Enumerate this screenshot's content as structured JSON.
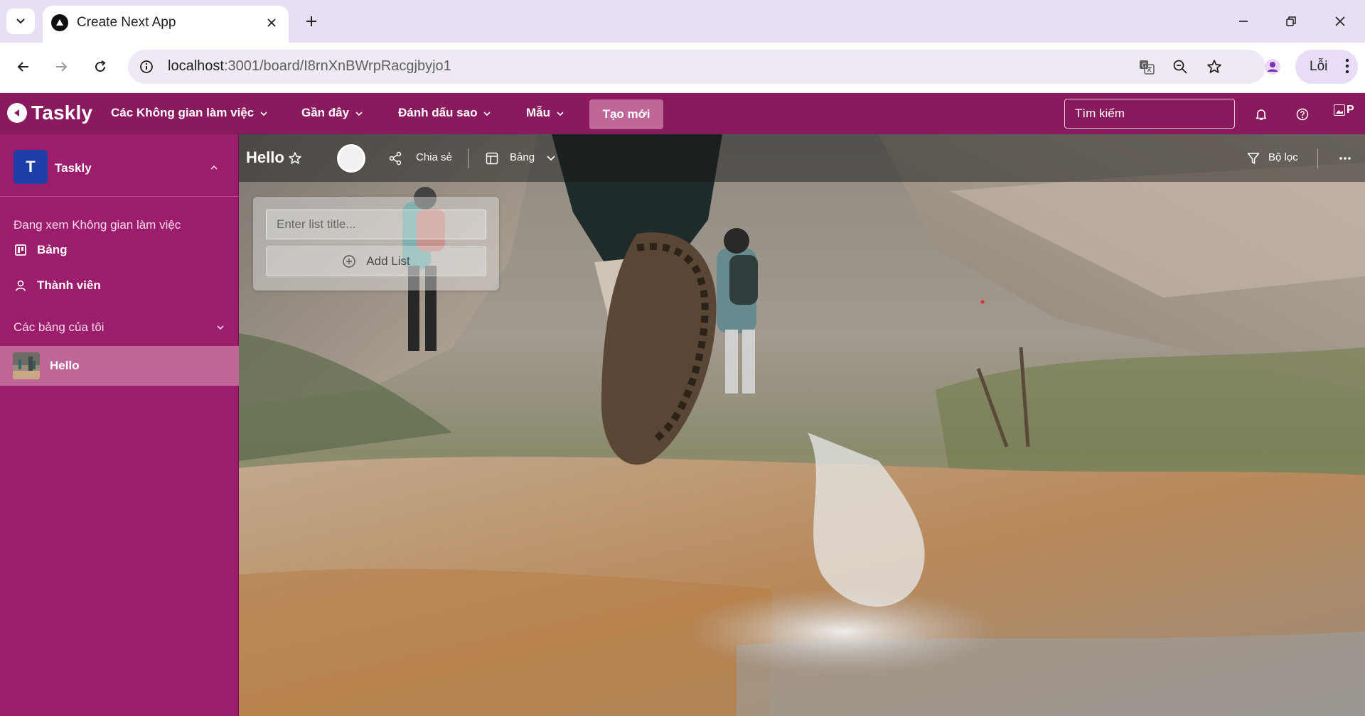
{
  "browser": {
    "tab_title": "Create Next App",
    "url_host": "localhost",
    "url_path": ":3001/board/I8rnXnBWrpRacgjbyjo1",
    "profile_chip_label": "Lỗi"
  },
  "header": {
    "logo_text": "Taskly",
    "nav": [
      {
        "label": "Các Không gian làm việc"
      },
      {
        "label": "Gần đây"
      },
      {
        "label": "Đánh dấu sao"
      },
      {
        "label": "Mẫu"
      }
    ],
    "create_label": "Tạo mới",
    "search_placeholder": "Tìm kiếm",
    "broken_image_alt": "P"
  },
  "sidebar": {
    "workspace_initial": "T",
    "workspace_name": "Taskly",
    "viewing_caption": "Đang xem Không gian làm việc",
    "items": [
      {
        "label": "Bảng",
        "icon": "board-icon"
      },
      {
        "label": "Thành viên",
        "icon": "user-icon"
      }
    ],
    "my_boards_label": "Các bảng của tôi",
    "boards": [
      {
        "label": "Hello"
      }
    ]
  },
  "board": {
    "title": "Hello",
    "share_label": "Chia sẻ",
    "view_label": "Bảng",
    "filter_label": "Bộ lọc",
    "new_list": {
      "placeholder": "Enter list title...",
      "add_label": "Add List"
    }
  },
  "colors": {
    "header_bg": "#8a1a5e",
    "sidebar_bg": "#9c1d6b",
    "active_item_bg": "#c0679a",
    "workspace_avatar": "#1f3fa8"
  }
}
